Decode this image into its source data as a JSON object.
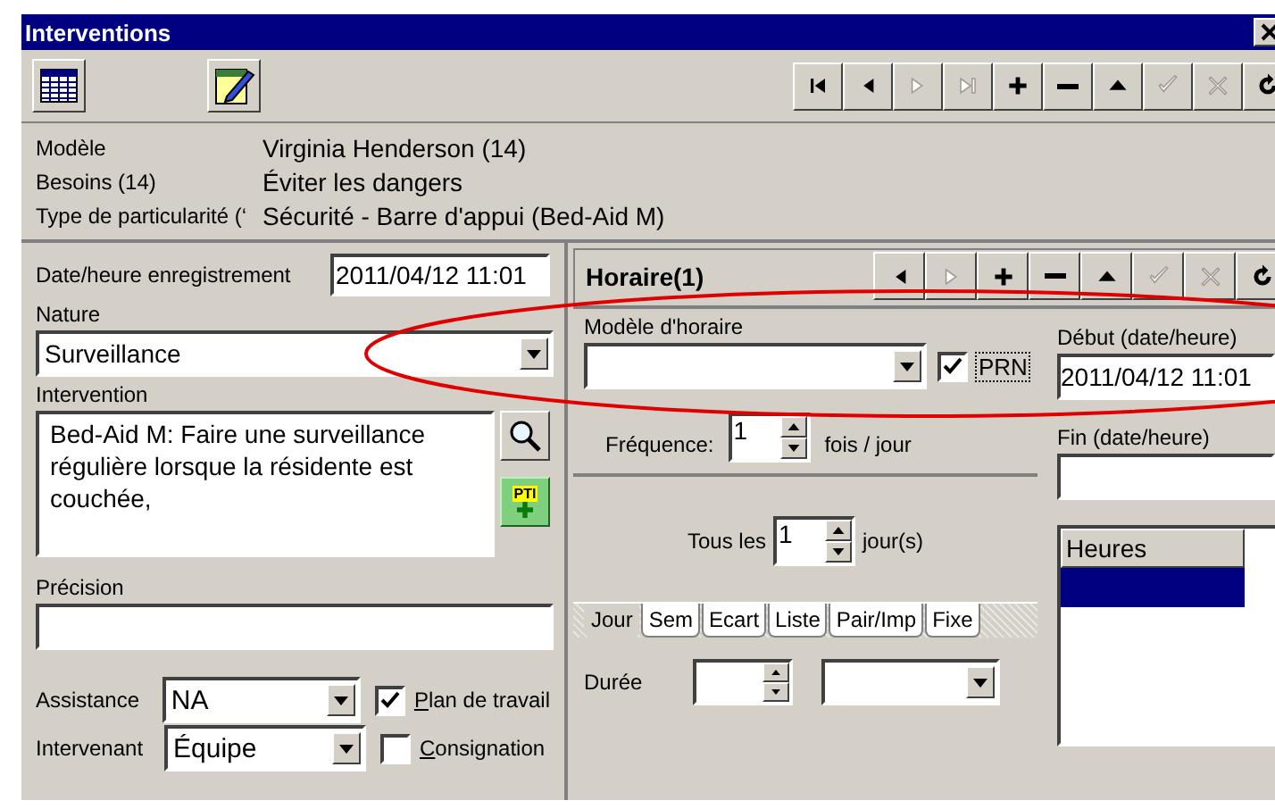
{
  "window": {
    "title": "Interventions"
  },
  "toolbar": {
    "tools": [
      {
        "kind": "grid"
      },
      {
        "kind": "edit"
      }
    ],
    "nav": [
      {
        "kind": "first",
        "disabled": false
      },
      {
        "kind": "prev",
        "disabled": false
      },
      {
        "kind": "next",
        "disabled": true
      },
      {
        "kind": "last",
        "disabled": true
      },
      {
        "kind": "add",
        "disabled": false
      },
      {
        "kind": "remove",
        "disabled": false
      },
      {
        "kind": "up",
        "disabled": false
      },
      {
        "kind": "confirm",
        "disabled": true
      },
      {
        "kind": "cancel",
        "disabled": true
      },
      {
        "kind": "refresh",
        "disabled": false
      }
    ]
  },
  "info": [
    {
      "label": "Modèle",
      "value": "Virginia Henderson (14)"
    },
    {
      "label": "Besoins (14)",
      "value": "Éviter les dangers"
    },
    {
      "label": "Type de particularité (‘",
      "value": "Sécurité - Barre d'appui (Bed-Aid M)"
    }
  ],
  "form": {
    "date": {
      "label": "Date/heure enregistrement",
      "value": "2011/04/12 11:01"
    },
    "nature": {
      "label": "Nature",
      "value": "Surveillance"
    },
    "intervention": {
      "label": "Intervention",
      "value": "Bed-Aid M: Faire une surveillance régulière lorsque la résidente est couchée,"
    },
    "pti_label": "PTI",
    "precision": {
      "label": "Précision"
    },
    "selects": [
      {
        "label": "Assistance",
        "value": "NA",
        "check_label": "Plan de travail",
        "checked": true
      },
      {
        "label": "Intervenant",
        "value": "Équipe",
        "check_label": "Consignation",
        "checked": false
      }
    ]
  },
  "schedule": {
    "title": "Horaire(1)",
    "nav": [
      {
        "kind": "prev",
        "disabled": false
      },
      {
        "kind": "next",
        "disabled": true
      },
      {
        "kind": "add",
        "disabled": false
      },
      {
        "kind": "remove",
        "disabled": false
      },
      {
        "kind": "up",
        "disabled": false
      },
      {
        "kind": "confirm",
        "disabled": true
      },
      {
        "kind": "cancel",
        "disabled": true
      },
      {
        "kind": "refresh",
        "disabled": false
      }
    ],
    "model": {
      "label": "Modèle d'horaire"
    },
    "prn": {
      "label": "PRN",
      "checked": true
    },
    "start": {
      "label": "Début (date/heure)",
      "value": "2011/04/12 11:01"
    },
    "end": {
      "label": "Fin (date/heure)"
    },
    "frequency": {
      "label": "Fréquence:",
      "value": "1",
      "unit": "fois / jour"
    },
    "every": {
      "label": "Tous les",
      "value": "1",
      "unit": "jour(s)"
    },
    "tabs": [
      {
        "label": "Jour",
        "selected": true
      },
      {
        "label": "Sem",
        "selected": false
      },
      {
        "label": "Ecart",
        "selected": false
      },
      {
        "label": "Liste",
        "selected": false
      },
      {
        "label": "Pair/Imp",
        "selected": false
      },
      {
        "label": "Fixe",
        "selected": false
      }
    ],
    "duration": {
      "label": "Durée"
    },
    "hours": {
      "column": "Heures",
      "rows": [
        {
          "selected": true
        }
      ]
    }
  }
}
